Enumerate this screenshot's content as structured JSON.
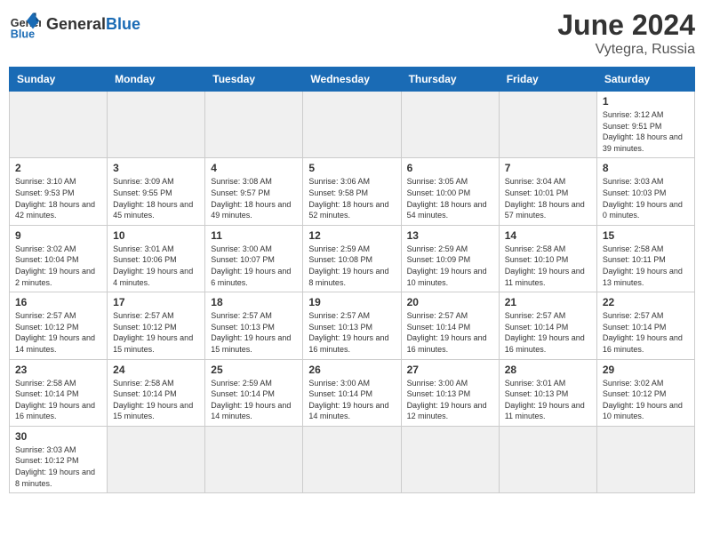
{
  "header": {
    "logo_general": "General",
    "logo_blue": "Blue",
    "title": "June 2024",
    "location": "Vytegra, Russia"
  },
  "weekdays": [
    "Sunday",
    "Monday",
    "Tuesday",
    "Wednesday",
    "Thursday",
    "Friday",
    "Saturday"
  ],
  "days": [
    {
      "num": "",
      "info": ""
    },
    {
      "num": "",
      "info": ""
    },
    {
      "num": "",
      "info": ""
    },
    {
      "num": "",
      "info": ""
    },
    {
      "num": "",
      "info": ""
    },
    {
      "num": "",
      "info": ""
    },
    {
      "num": "1",
      "info": "Sunrise: 3:12 AM\nSunset: 9:51 PM\nDaylight: 18 hours and 39 minutes."
    },
    {
      "num": "2",
      "info": "Sunrise: 3:10 AM\nSunset: 9:53 PM\nDaylight: 18 hours and 42 minutes."
    },
    {
      "num": "3",
      "info": "Sunrise: 3:09 AM\nSunset: 9:55 PM\nDaylight: 18 hours and 45 minutes."
    },
    {
      "num": "4",
      "info": "Sunrise: 3:08 AM\nSunset: 9:57 PM\nDaylight: 18 hours and 49 minutes."
    },
    {
      "num": "5",
      "info": "Sunrise: 3:06 AM\nSunset: 9:58 PM\nDaylight: 18 hours and 52 minutes."
    },
    {
      "num": "6",
      "info": "Sunrise: 3:05 AM\nSunset: 10:00 PM\nDaylight: 18 hours and 54 minutes."
    },
    {
      "num": "7",
      "info": "Sunrise: 3:04 AM\nSunset: 10:01 PM\nDaylight: 18 hours and 57 minutes."
    },
    {
      "num": "8",
      "info": "Sunrise: 3:03 AM\nSunset: 10:03 PM\nDaylight: 19 hours and 0 minutes."
    },
    {
      "num": "9",
      "info": "Sunrise: 3:02 AM\nSunset: 10:04 PM\nDaylight: 19 hours and 2 minutes."
    },
    {
      "num": "10",
      "info": "Sunrise: 3:01 AM\nSunset: 10:06 PM\nDaylight: 19 hours and 4 minutes."
    },
    {
      "num": "11",
      "info": "Sunrise: 3:00 AM\nSunset: 10:07 PM\nDaylight: 19 hours and 6 minutes."
    },
    {
      "num": "12",
      "info": "Sunrise: 2:59 AM\nSunset: 10:08 PM\nDaylight: 19 hours and 8 minutes."
    },
    {
      "num": "13",
      "info": "Sunrise: 2:59 AM\nSunset: 10:09 PM\nDaylight: 19 hours and 10 minutes."
    },
    {
      "num": "14",
      "info": "Sunrise: 2:58 AM\nSunset: 10:10 PM\nDaylight: 19 hours and 11 minutes."
    },
    {
      "num": "15",
      "info": "Sunrise: 2:58 AM\nSunset: 10:11 PM\nDaylight: 19 hours and 13 minutes."
    },
    {
      "num": "16",
      "info": "Sunrise: 2:57 AM\nSunset: 10:12 PM\nDaylight: 19 hours and 14 minutes."
    },
    {
      "num": "17",
      "info": "Sunrise: 2:57 AM\nSunset: 10:12 PM\nDaylight: 19 hours and 15 minutes."
    },
    {
      "num": "18",
      "info": "Sunrise: 2:57 AM\nSunset: 10:13 PM\nDaylight: 19 hours and 15 minutes."
    },
    {
      "num": "19",
      "info": "Sunrise: 2:57 AM\nSunset: 10:13 PM\nDaylight: 19 hours and 16 minutes."
    },
    {
      "num": "20",
      "info": "Sunrise: 2:57 AM\nSunset: 10:14 PM\nDaylight: 19 hours and 16 minutes."
    },
    {
      "num": "21",
      "info": "Sunrise: 2:57 AM\nSunset: 10:14 PM\nDaylight: 19 hours and 16 minutes."
    },
    {
      "num": "22",
      "info": "Sunrise: 2:57 AM\nSunset: 10:14 PM\nDaylight: 19 hours and 16 minutes."
    },
    {
      "num": "23",
      "info": "Sunrise: 2:58 AM\nSunset: 10:14 PM\nDaylight: 19 hours and 16 minutes."
    },
    {
      "num": "24",
      "info": "Sunrise: 2:58 AM\nSunset: 10:14 PM\nDaylight: 19 hours and 15 minutes."
    },
    {
      "num": "25",
      "info": "Sunrise: 2:59 AM\nSunset: 10:14 PM\nDaylight: 19 hours and 14 minutes."
    },
    {
      "num": "26",
      "info": "Sunrise: 3:00 AM\nSunset: 10:14 PM\nDaylight: 19 hours and 14 minutes."
    },
    {
      "num": "27",
      "info": "Sunrise: 3:00 AM\nSunset: 10:13 PM\nDaylight: 19 hours and 12 minutes."
    },
    {
      "num": "28",
      "info": "Sunrise: 3:01 AM\nSunset: 10:13 PM\nDaylight: 19 hours and 11 minutes."
    },
    {
      "num": "29",
      "info": "Sunrise: 3:02 AM\nSunset: 10:12 PM\nDaylight: 19 hours and 10 minutes."
    },
    {
      "num": "30",
      "info": "Sunrise: 3:03 AM\nSunset: 10:12 PM\nDaylight: 19 hours and 8 minutes."
    },
    {
      "num": "",
      "info": ""
    },
    {
      "num": "",
      "info": ""
    },
    {
      "num": "",
      "info": ""
    },
    {
      "num": "",
      "info": ""
    },
    {
      "num": "",
      "info": ""
    },
    {
      "num": "",
      "info": ""
    }
  ]
}
